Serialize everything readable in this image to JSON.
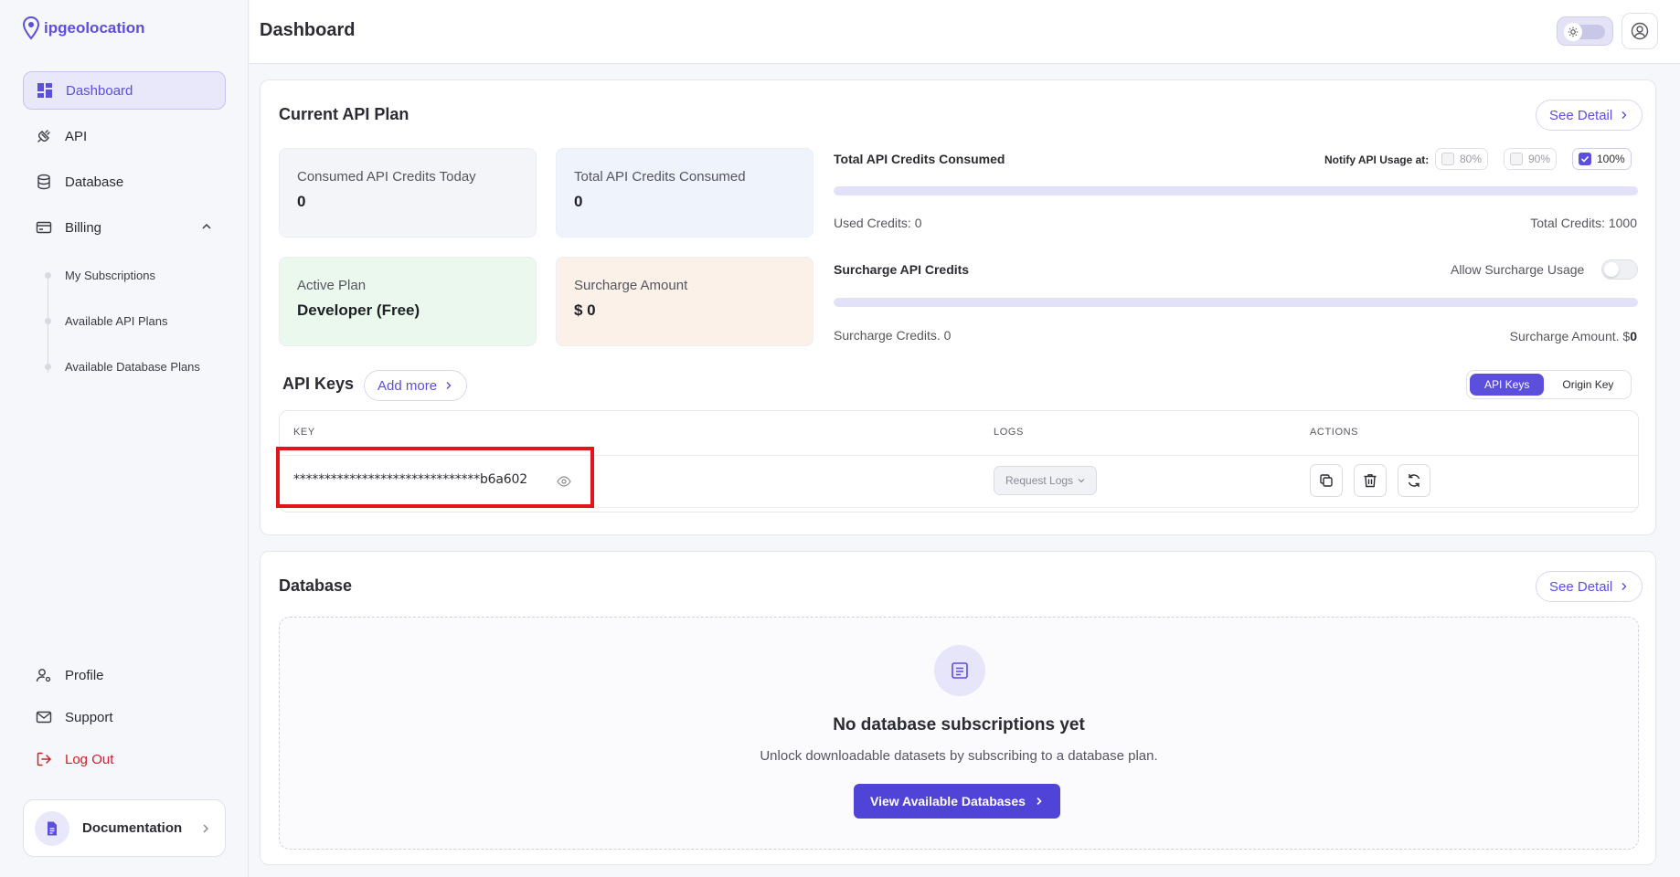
{
  "app": {
    "logo_text": "ipgeolocation"
  },
  "sidebar": {
    "items": [
      {
        "label": "Dashboard"
      },
      {
        "label": "API"
      },
      {
        "label": "Database"
      },
      {
        "label": "Billing"
      }
    ],
    "billing_sub": [
      {
        "label": "My Subscriptions"
      },
      {
        "label": "Available API Plans"
      },
      {
        "label": "Available Database Plans"
      }
    ],
    "bottom": [
      {
        "label": "Profile"
      },
      {
        "label": "Support"
      },
      {
        "label": "Log Out"
      }
    ],
    "documentation_label": "Documentation"
  },
  "header": {
    "title": "Dashboard"
  },
  "api_plan": {
    "title": "Current API Plan",
    "see_detail": "See Detail",
    "stats": [
      {
        "label": "Consumed API Credits Today",
        "value": "0"
      },
      {
        "label": "Total API Credits Consumed",
        "value": "0"
      },
      {
        "label": "Active Plan",
        "value": "Developer (Free)"
      },
      {
        "label": "Surcharge Amount",
        "value": "$ 0"
      }
    ],
    "consumed_title": "Total API Credits Consumed",
    "notify_label": "Notify API Usage at:",
    "notify_options": [
      {
        "label": "80%",
        "checked": false
      },
      {
        "label": "90%",
        "checked": false
      },
      {
        "label": "100%",
        "checked": true
      }
    ],
    "consumed_fraction": 0,
    "used_credits": "Used Credits: 0",
    "total_credits": "Total Credits: 1000",
    "surcharge_title": "Surcharge API Credits",
    "allow_surcharge_label": "Allow Surcharge Usage",
    "surcharge_fraction": 0,
    "surcharge_credits": "Surcharge Credits. 0",
    "surcharge_amount_prefix": "Surcharge Amount. $",
    "surcharge_amount_value": "0"
  },
  "api_keys": {
    "title": "API Keys",
    "add_more": "Add more",
    "tabs": [
      {
        "label": "API Keys"
      },
      {
        "label": "Origin Key"
      }
    ],
    "columns": {
      "key": "KEY",
      "logs": "LOGS",
      "actions": "ACTIONS"
    },
    "rows": [
      {
        "key": "******************************b6a602",
        "logs_button": "Request Logs"
      }
    ]
  },
  "database": {
    "title": "Database",
    "see_detail": "See Detail",
    "empty_title": "No database subscriptions yet",
    "empty_text": "Unlock downloadable datasets by subscribing to a database plan.",
    "cta": "View Available Databases"
  },
  "colors": {
    "accent": "#5b4fdc",
    "danger": "#d0202a",
    "highlight": "#e3141b"
  }
}
